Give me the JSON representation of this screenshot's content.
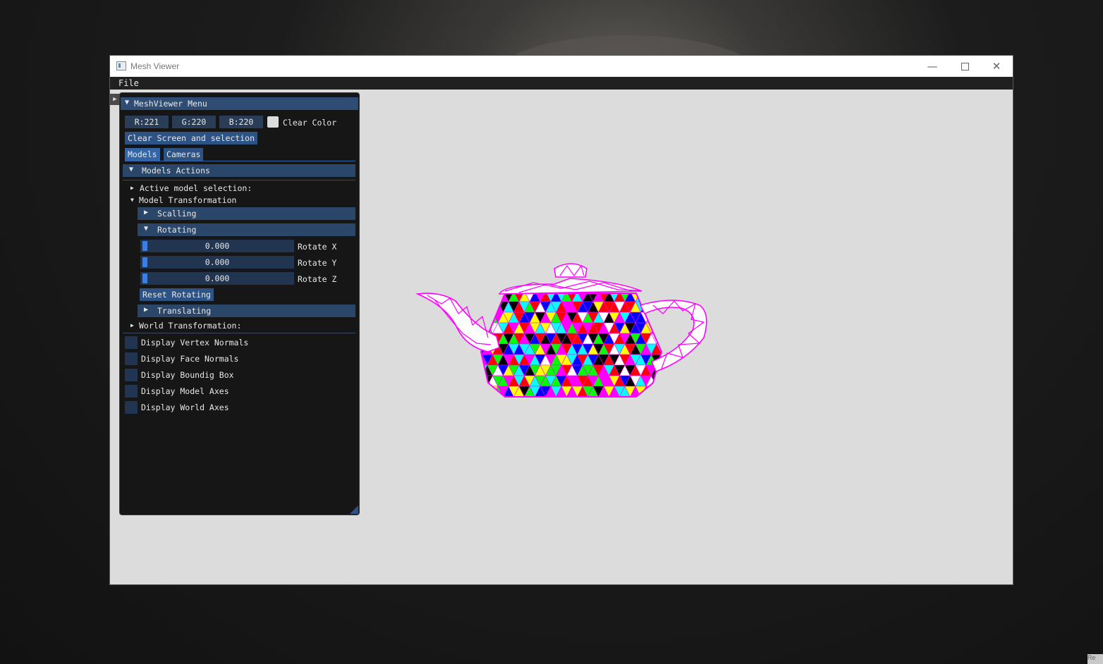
{
  "window": {
    "title": "Mesh Viewer"
  },
  "menubar": {
    "file": "File"
  },
  "panel": {
    "title": "MeshViewer Menu",
    "clear_color": {
      "r": "R:221",
      "g": "G:220",
      "b": "B:220",
      "label": "Clear Color",
      "swatch": "#dddcdc"
    },
    "clear_button": "Clear Screen and selection",
    "tabs": [
      "Models",
      "Cameras"
    ],
    "models_actions": "Models Actions",
    "active_model_selection": "Active model selection:",
    "model_transformation": "Model Transformation",
    "scalling": "Scalling",
    "rotating": "Rotating",
    "sliders": [
      {
        "value": "0.000",
        "label": "Rotate X"
      },
      {
        "value": "0.000",
        "label": "Rotate Y"
      },
      {
        "value": "0.000",
        "label": "Rotate Z"
      }
    ],
    "reset_rotating": "Reset Rotating",
    "translating": "Translating",
    "world_transformation": "World Transformation:",
    "checkboxes": [
      {
        "label": "Display Vertex Normals",
        "checked": false
      },
      {
        "label": "Display Face Normals",
        "checked": false
      },
      {
        "label": "Display Boundig Box",
        "checked": false
      },
      {
        "label": "Display Model Axes",
        "checked": false
      },
      {
        "label": "Display World Axes",
        "checked": false
      }
    ]
  },
  "scene": {
    "background": "#dcdcdc",
    "model": "teapot-wireframe",
    "palette": [
      "#ff00ff",
      "#00ffff",
      "#ffff00",
      "#ff0000",
      "#00ff00",
      "#0000ff",
      "#ffffff",
      "#000000"
    ]
  },
  "taskbar_corner": "Re"
}
